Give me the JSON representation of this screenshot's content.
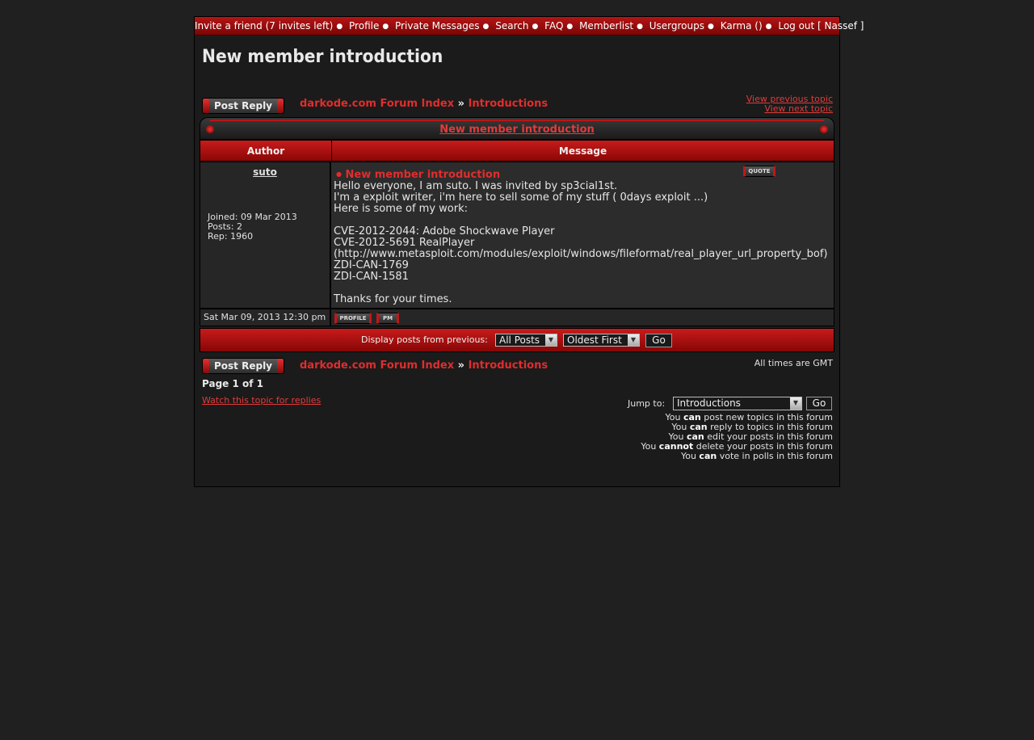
{
  "topnav": {
    "items": [
      "Invite a friend (7 invites left)",
      "Profile",
      "Private Messages",
      "Search",
      "FAQ",
      "Memberlist",
      "Usergroups",
      "Karma ()",
      "Log out [ Nassef ]"
    ]
  },
  "page_title": "New member introduction",
  "post_reply_label": "Post Reply",
  "breadcrumb": {
    "index": "darkode.com Forum Index",
    "sep": "»",
    "forum": "Introductions"
  },
  "topic_nav": {
    "previous": "View previous topic",
    "next": "View next topic"
  },
  "panel_title": "New member introduction",
  "columns": {
    "author": "Author",
    "message": "Message"
  },
  "post": {
    "author": "suto",
    "joined": "Joined: 09 Mar 2013",
    "posts": "Posts: 2",
    "rep": "Rep: 1960",
    "subject": "New member introduction",
    "quote_label": "QUOTE",
    "lines": [
      "Hello everyone, I am suto. I was invited by sp3cial1st.",
      "I'm a exploit writer, i'm here to sell some of my stuff ( 0days exploit ...)",
      "Here is some of my work:",
      "",
      "CVE-2012-2044: Adobe Shockwave Player",
      "CVE-2012-5691 RealPlayer",
      "(http://www.metasploit.com/modules/exploit/windows/fileformat/real_player_url_property_bof)",
      "ZDI-CAN-1769",
      "ZDI-CAN-1581",
      "",
      "Thanks for your times."
    ],
    "date": "Sat Mar 09, 2013 12:30 pm",
    "profile_label": "PROFILE",
    "pm_label": "PM"
  },
  "filter": {
    "label": "Display posts from previous:",
    "posts": "All Posts",
    "order": "Oldest First",
    "go": "Go"
  },
  "timezone": "All times are GMT",
  "pagination": "Page 1 of 1",
  "watch": "Watch this topic for replies",
  "jump": {
    "label": "Jump to:",
    "value": "Introductions",
    "go": "Go"
  },
  "permissions": [
    {
      "pre": "You ",
      "word": "can",
      "post": " post new topics in this forum"
    },
    {
      "pre": "You ",
      "word": "can",
      "post": " reply to topics in this forum"
    },
    {
      "pre": "You ",
      "word": "can",
      "post": " edit your posts in this forum"
    },
    {
      "pre": "You ",
      "word": "cannot",
      "post": " delete your posts in this forum"
    },
    {
      "pre": "You ",
      "word": "can",
      "post": " vote in polls in this forum"
    }
  ],
  "colors": {
    "accent": "#c81b1b",
    "link": "#e02d2d",
    "background": "#202020"
  }
}
